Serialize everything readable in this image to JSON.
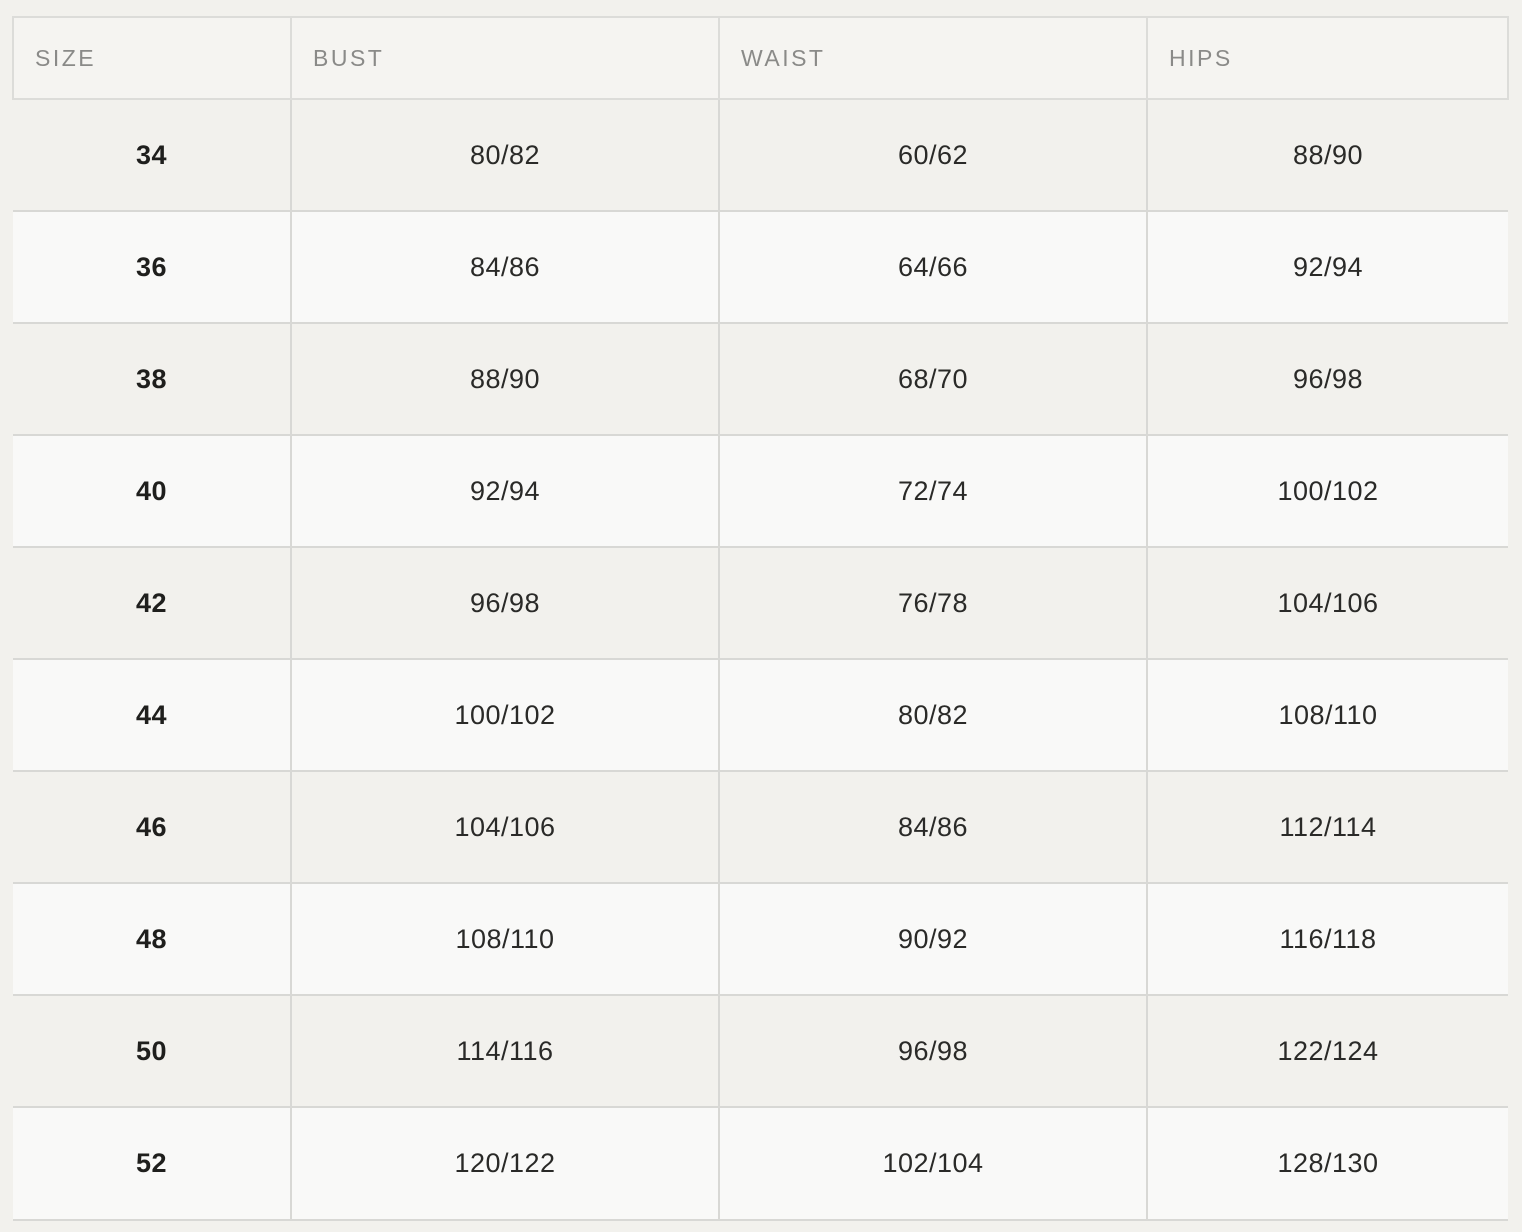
{
  "headers": {
    "size": "SIZE",
    "bust": "BUST",
    "waist": "WAIST",
    "hips": "HIPS"
  },
  "rows": [
    {
      "size": "34",
      "bust": "80/82",
      "waist": "60/62",
      "hips": "88/90"
    },
    {
      "size": "36",
      "bust": "84/86",
      "waist": "64/66",
      "hips": "92/94"
    },
    {
      "size": "38",
      "bust": "88/90",
      "waist": "68/70",
      "hips": "96/98"
    },
    {
      "size": "40",
      "bust": "92/94",
      "waist": "72/74",
      "hips": "100/102"
    },
    {
      "size": "42",
      "bust": "96/98",
      "waist": "76/78",
      "hips": "104/106"
    },
    {
      "size": "44",
      "bust": "100/102",
      "waist": "80/82",
      "hips": "108/110"
    },
    {
      "size": "46",
      "bust": "104/106",
      "waist": "84/86",
      "hips": "112/114"
    },
    {
      "size": "48",
      "bust": "108/110",
      "waist": "90/92",
      "hips": "116/118"
    },
    {
      "size": "50",
      "bust": "114/116",
      "waist": "96/98",
      "hips": "122/124"
    },
    {
      "size": "52",
      "bust": "120/122",
      "waist": "102/104",
      "hips": "128/130"
    }
  ]
}
